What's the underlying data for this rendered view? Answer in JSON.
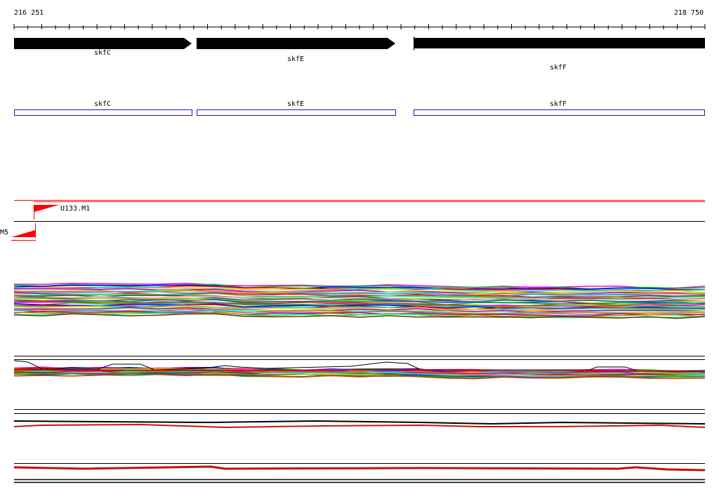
{
  "ruler": {
    "start_label": "216 251",
    "end_label": "218 750"
  },
  "genes": [
    {
      "name": "skfC"
    },
    {
      "name": "skfE"
    },
    {
      "name": "skfF"
    }
  ],
  "cds": [
    {
      "name": "skfC"
    },
    {
      "name": "skfE"
    },
    {
      "name": "skfF"
    }
  ],
  "features": [
    {
      "label": "U133.M1"
    },
    {
      "label": "M5"
    }
  ],
  "colors": {
    "gene_arrow": "#000000",
    "cds_box": "#1a1ab8",
    "feature": "#ff0000",
    "track_line": "#000000"
  }
}
